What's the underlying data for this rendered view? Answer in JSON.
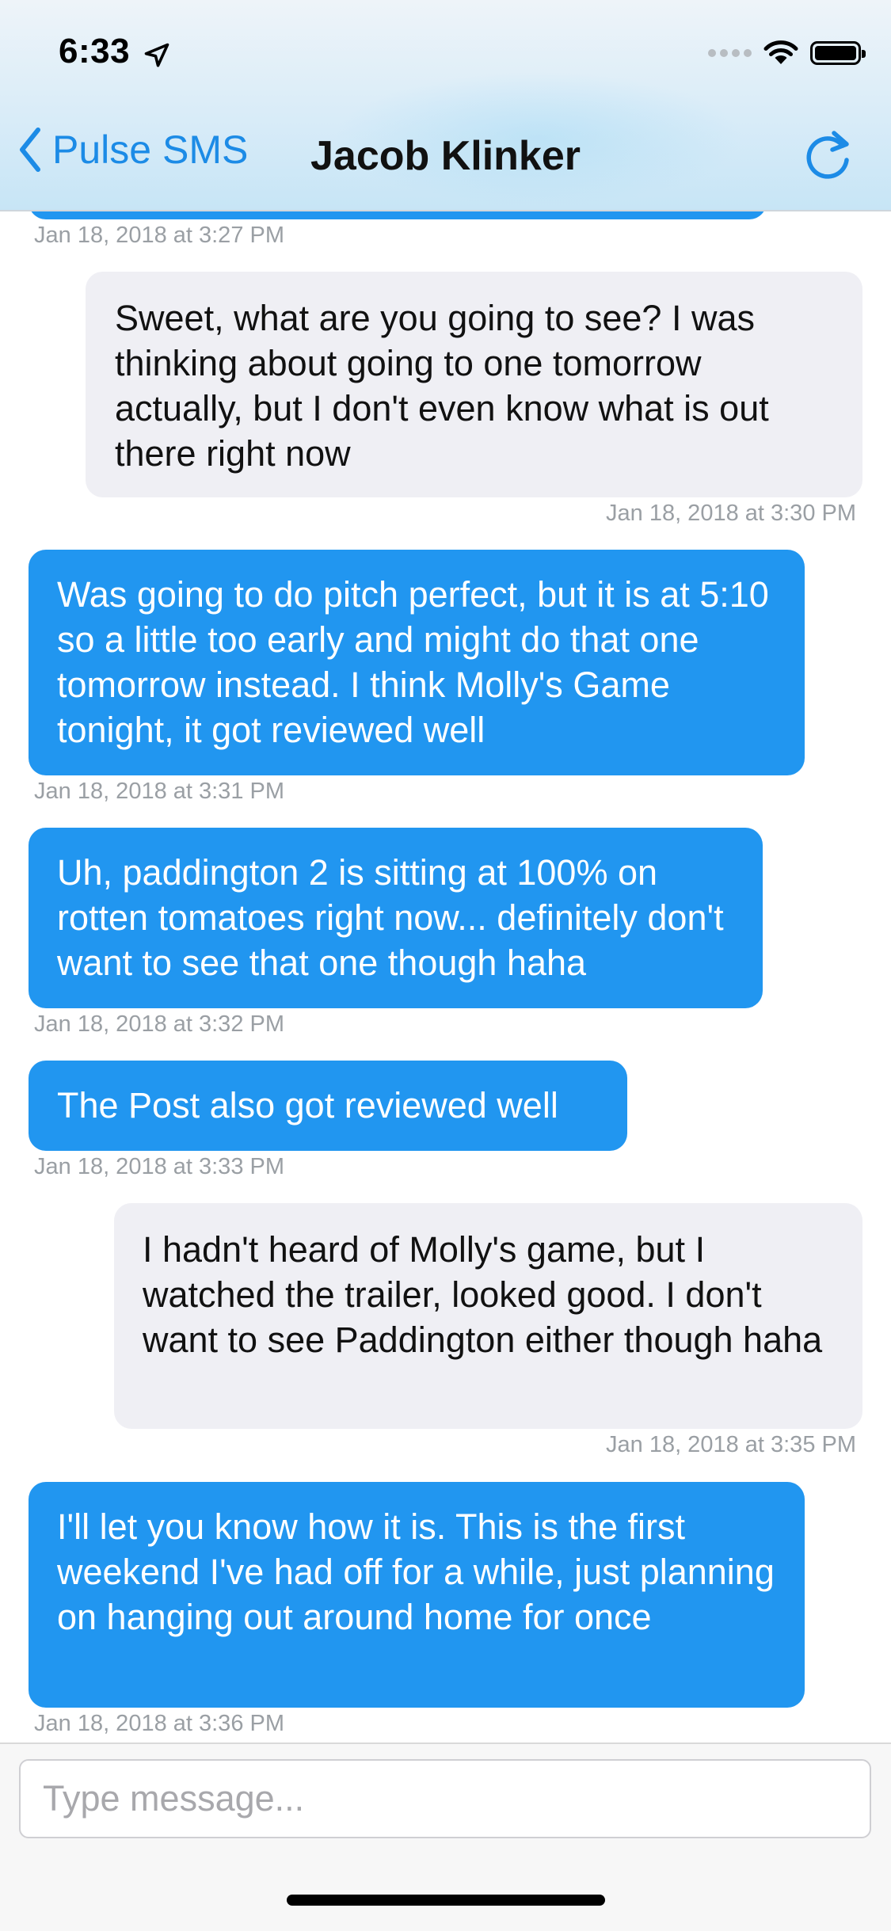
{
  "status_bar": {
    "time": "6:33"
  },
  "nav": {
    "back_label": "Pulse SMS",
    "title": "Jacob Klinker"
  },
  "messages": [
    {
      "direction": "incoming",
      "text": "",
      "timestamp": "Jan 18, 2018 at 3:27 PM"
    },
    {
      "direction": "outgoing",
      "text": "Sweet, what are you going to see? I was thinking about going to one tomorrow actually, but I don't even know what is out there right now",
      "timestamp": "Jan 18, 2018 at 3:30 PM"
    },
    {
      "direction": "incoming",
      "text": "Was going to do pitch perfect, but it is at 5:10 so a little too early and might do that one tomorrow instead. I think Molly's Game tonight, it got reviewed well",
      "timestamp": "Jan 18, 2018 at 3:31 PM"
    },
    {
      "direction": "incoming",
      "text": "Uh, paddington 2 is sitting at 100% on rotten tomatoes right now... definitely don't want to see that one though haha",
      "timestamp": "Jan 18, 2018 at 3:32 PM"
    },
    {
      "direction": "incoming",
      "text": "The Post also got reviewed well",
      "timestamp": "Jan 18, 2018 at 3:33 PM"
    },
    {
      "direction": "outgoing",
      "text": "I hadn't heard of Molly's game, but I watched the trailer, looked good. I don't want to see Paddington either though haha",
      "timestamp": "Jan 18, 2018 at 3:35 PM"
    },
    {
      "direction": "incoming",
      "text": "I'll let you know how it is. This is the first weekend I've had off for a while, just planning on hanging out around home for once",
      "timestamp": "Jan 18, 2018 at 3:36 PM"
    }
  ],
  "composer": {
    "placeholder": "Type message..."
  },
  "colors": {
    "incoming_bubble": "#2196f0",
    "outgoing_bubble": "#efeff4",
    "accent": "#1c8be6",
    "timestamp": "#9a9fa4"
  }
}
